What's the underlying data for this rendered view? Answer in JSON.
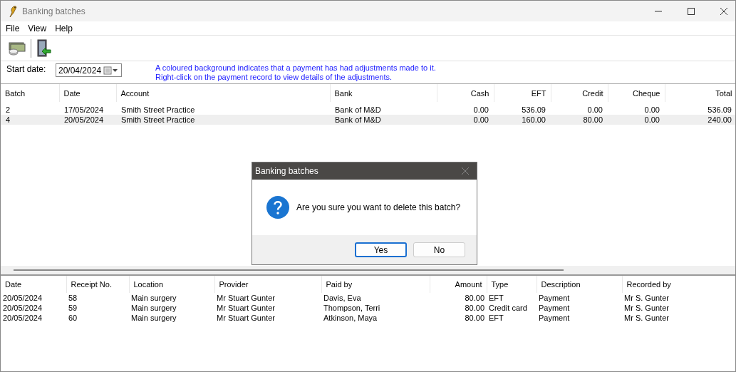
{
  "window": {
    "title": "Banking batches"
  },
  "menu": [
    "File",
    "View",
    "Help"
  ],
  "filter": {
    "label": "Start date:",
    "value": "20/04/2024",
    "notice": [
      "A coloured background indicates that a payment has had adjustments made to it.",
      "Right-click on the payment record to view details of the adjustments."
    ]
  },
  "batches": {
    "columns": [
      {
        "label": "Batch",
        "numeric": false
      },
      {
        "label": "Date",
        "numeric": false
      },
      {
        "label": "Account",
        "numeric": false
      },
      {
        "label": "Bank",
        "numeric": false
      },
      {
        "label": "Cash",
        "numeric": true
      },
      {
        "label": "EFT",
        "numeric": true
      },
      {
        "label": "Credit",
        "numeric": true
      },
      {
        "label": "Cheque",
        "numeric": true
      },
      {
        "label": "Total",
        "numeric": true
      }
    ],
    "rows": [
      {
        "selected": false,
        "cells": [
          "2",
          "17/05/2024",
          "Smith Street Practice",
          "Bank of M&D",
          "0.00",
          "536.09",
          "0.00",
          "0.00",
          "536.09"
        ]
      },
      {
        "selected": true,
        "cells": [
          "4",
          "20/05/2024",
          "Smith Street Practice",
          "Bank of M&D",
          "0.00",
          "160.00",
          "80.00",
          "0.00",
          "240.00"
        ]
      }
    ]
  },
  "payments": {
    "columns": [
      {
        "label": "Date",
        "numeric": false
      },
      {
        "label": "Receipt No.",
        "numeric": false
      },
      {
        "label": "Location",
        "numeric": false
      },
      {
        "label": "Provider",
        "numeric": false
      },
      {
        "label": "Paid by",
        "numeric": false
      },
      {
        "label": "Amount",
        "numeric": true
      },
      {
        "label": "Type",
        "numeric": false
      },
      {
        "label": "Description",
        "numeric": false
      },
      {
        "label": "Recorded by",
        "numeric": false
      }
    ],
    "rows": [
      {
        "selected": false,
        "cells": [
          "20/05/2024",
          "58",
          "Main surgery",
          "Mr Stuart Gunter",
          "Davis, Eva",
          "80.00",
          "EFT",
          "Payment",
          "Mr S. Gunter"
        ]
      },
      {
        "selected": false,
        "cells": [
          "20/05/2024",
          "59",
          "Main surgery",
          "Mr Stuart Gunter",
          "Thompson, Terri",
          "80.00",
          "Credit card",
          "Payment",
          "Mr S. Gunter"
        ]
      },
      {
        "selected": false,
        "cells": [
          "20/05/2024",
          "60",
          "Main surgery",
          "Mr Stuart Gunter",
          "Atkinson, Maya",
          "80.00",
          "EFT",
          "Payment",
          "Mr S. Gunter"
        ]
      }
    ]
  },
  "dialog": {
    "title": "Banking batches",
    "message": "Are you sure you want to delete this batch?",
    "buttons": [
      {
        "label": "Yes",
        "focused": true
      },
      {
        "label": "No",
        "focused": false
      }
    ]
  }
}
